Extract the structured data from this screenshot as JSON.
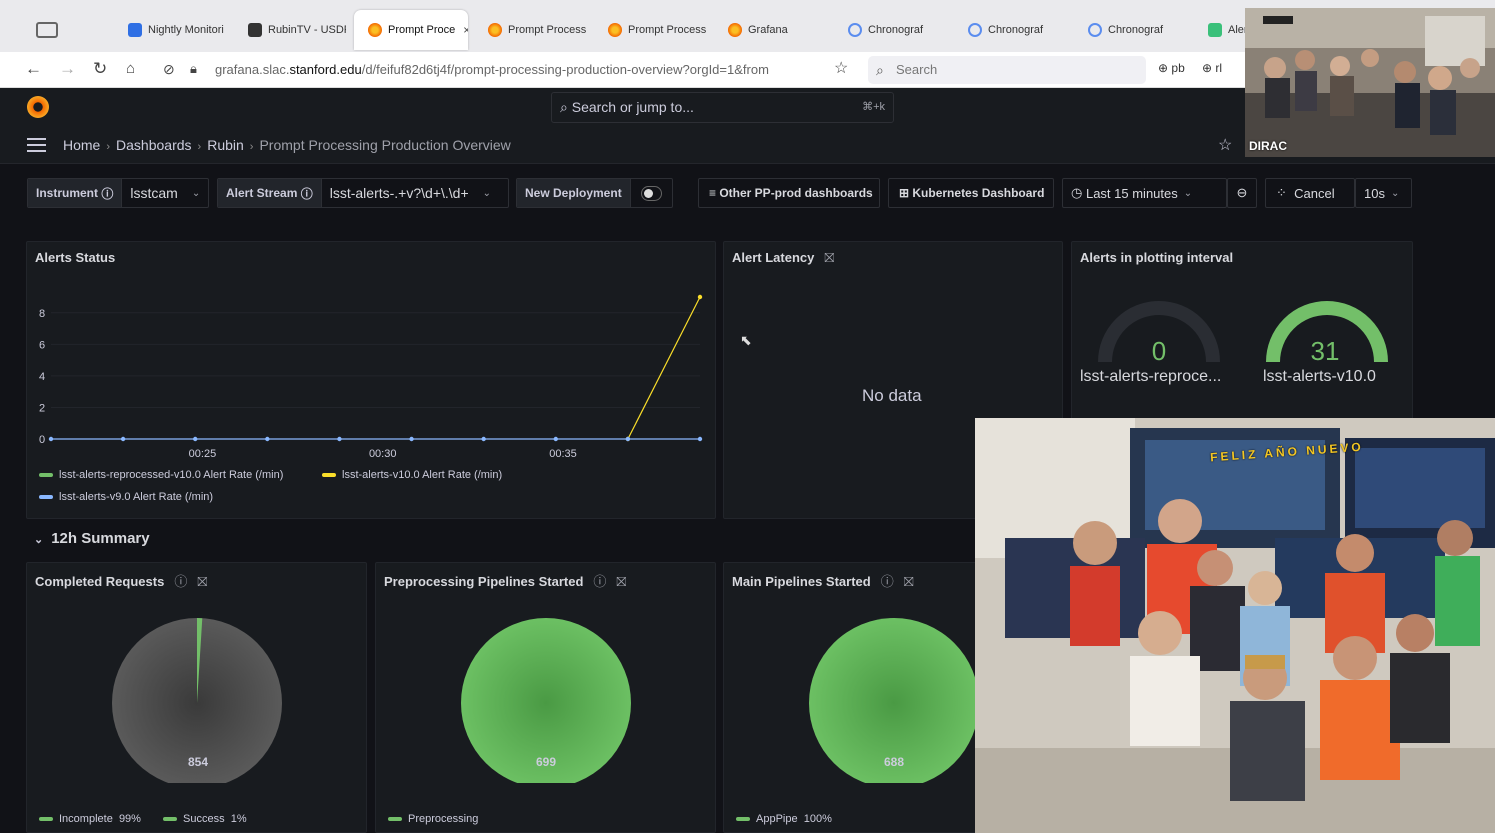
{
  "browser": {
    "tabs": [
      {
        "label": "",
        "icon": "sidebar-icon"
      },
      {
        "label": "Nightly Monitori",
        "icon": "blue-square-icon"
      },
      {
        "label": "RubinTV - USDF",
        "icon": "tv-icon"
      },
      {
        "label": "Prompt Proce",
        "icon": "grafana-icon",
        "active": true
      },
      {
        "label": "Prompt Process",
        "icon": "grafana-icon"
      },
      {
        "label": "Prompt Process",
        "icon": "grafana-icon"
      },
      {
        "label": "Grafana",
        "icon": "grafana-icon"
      },
      {
        "label": "Chronograf",
        "icon": "chronograf-icon"
      },
      {
        "label": "Chronograf",
        "icon": "chronograf-icon"
      },
      {
        "label": "Chronograf",
        "icon": "chronograf-icon"
      },
      {
        "label": "Aler",
        "icon": "alert-icon"
      }
    ],
    "tab_close": "×",
    "url_prefix": "grafana.slac.",
    "url_domain": "stanford.edu",
    "url_path": "/d/feifuf82d6tj4f/prompt-processing-production-overview?orgId=1&from",
    "search_placeholder": "Search",
    "extensions": [
      "pb",
      "rl"
    ]
  },
  "grafana": {
    "search_placeholder": "Search or jump to...",
    "search_shortcut": "⌘+k",
    "breadcrumbs": [
      "Home",
      "Dashboards",
      "Rubin",
      "Prompt Processing Production Overview"
    ],
    "variables": {
      "instrument_label": "Instrument",
      "instrument_value": "lsstcam",
      "alert_stream_label": "Alert Stream",
      "alert_stream_value": "lsst-alerts-.+v?\\d+\\.\\d+",
      "new_deployment_label": "New Deployment",
      "other_dashboards": "Other PP-prod dashboards",
      "kubernetes_dashboard": "Kubernetes Dashboard",
      "time_range": "Last 15 minutes",
      "cancel": "Cancel",
      "refresh": "10s"
    },
    "panels": {
      "alerts_status": {
        "title": "Alerts Status",
        "legend": [
          {
            "name": "lsst-alerts-reprocessed-v10.0 Alert Rate (/min)",
            "color": "#73bf69"
          },
          {
            "name": "lsst-alerts-v10.0 Alert Rate (/min)",
            "color": "#fade2a"
          },
          {
            "name": "lsst-alerts-v9.0 Alert Rate (/min)",
            "color": "#8ab8ff"
          }
        ]
      },
      "alert_latency": {
        "title": "Alert Latency",
        "empty": "No data"
      },
      "alerts_interval": {
        "title": "Alerts in plotting interval",
        "gauges": [
          {
            "value": "0",
            "label": "lsst-alerts-reproce...",
            "color": "#73bf69",
            "fraction": 0
          },
          {
            "value": "31",
            "label": "lsst-alerts-v10.0",
            "color": "#73bf69",
            "fraction": 1
          }
        ]
      },
      "summary_row": "12h Summary",
      "completed_requests": {
        "title": "Completed Requests",
        "center": "854",
        "legend": [
          {
            "name": "Incomplete",
            "pct": "99%",
            "color": "#73bf69"
          },
          {
            "name": "Success",
            "pct": "1%",
            "color": "#73bf69"
          }
        ]
      },
      "preprocessing": {
        "title": "Preprocessing Pipelines Started",
        "center": "699",
        "legend": [
          {
            "name": "Preprocessing",
            "color": "#73bf69"
          }
        ]
      },
      "main_pipelines": {
        "title": "Main Pipelines Started",
        "center": "688",
        "legend": [
          {
            "name": "AppPipe",
            "pct": "100%",
            "color": "#73bf69"
          }
        ]
      }
    }
  },
  "chart_data": [
    {
      "type": "line",
      "x": [
        "00:25",
        "00:30",
        "00:35"
      ],
      "ylim": [
        0,
        9
      ],
      "yticks": [
        "0",
        "2",
        "4",
        "6",
        "8"
      ],
      "series": [
        {
          "name": "lsst-alerts-reprocessed-v10.0 Alert Rate (/min)",
          "color": "#73bf69",
          "points": []
        },
        {
          "name": "lsst-alerts-v10.0 Alert Rate (/min)",
          "color": "#fade2a",
          "points": [
            [
              8,
              0
            ],
            [
              9,
              9
            ]
          ]
        },
        {
          "name": "lsst-alerts-v9.0 Alert Rate (/min)",
          "color": "#8ab8ff",
          "points": [
            [
              0,
              0
            ],
            [
              1,
              0
            ],
            [
              2,
              0
            ],
            [
              3,
              0
            ],
            [
              4,
              0
            ],
            [
              5,
              0
            ],
            [
              6,
              0
            ],
            [
              7,
              0
            ],
            [
              8,
              0
            ],
            [
              9,
              0
            ]
          ]
        }
      ]
    },
    {
      "type": "pie",
      "title": "Completed Requests",
      "slices": [
        {
          "name": "Incomplete",
          "value": 99
        },
        {
          "name": "Success",
          "value": 1
        }
      ]
    },
    {
      "type": "pie",
      "title": "Preprocessing Pipelines Started",
      "slices": [
        {
          "name": "Preprocessing",
          "value": 100
        }
      ]
    },
    {
      "type": "pie",
      "title": "Main Pipelines Started",
      "slices": [
        {
          "name": "AppPipe",
          "value": 100
        }
      ]
    }
  ],
  "overlays": {
    "video_label": "DIRAC",
    "banner_text": "FELIZ AÑO NUEVO"
  }
}
